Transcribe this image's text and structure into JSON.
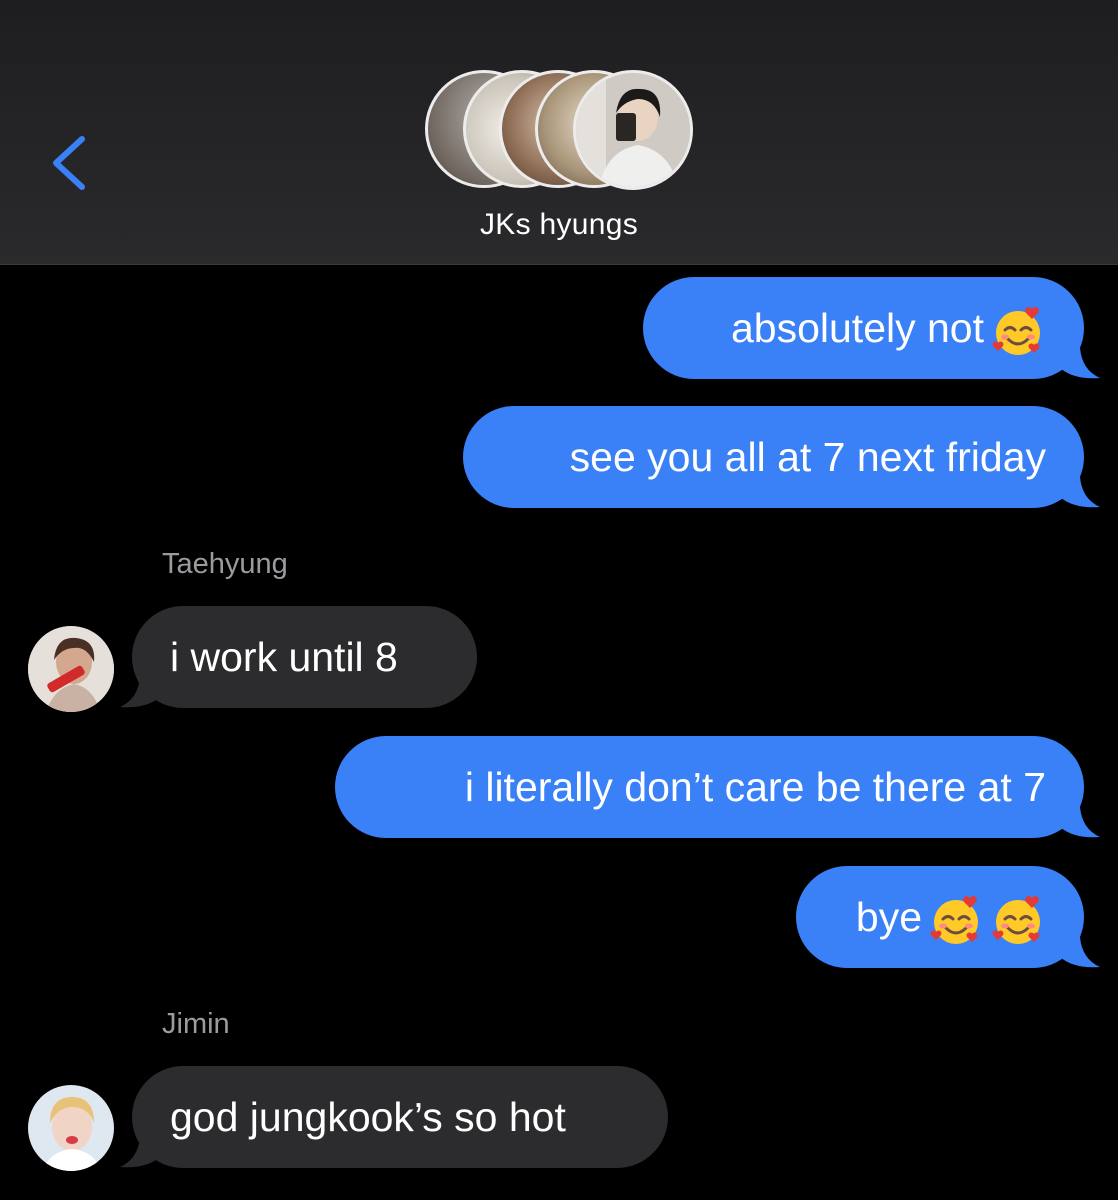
{
  "header": {
    "back_icon": "chevron-left-icon",
    "group_name": "JKs hyungs",
    "group_avatar_count": 5
  },
  "messages": [
    {
      "direction": "sent",
      "text": "absolutely not",
      "emojis": [
        "smiling-face-with-hearts"
      ]
    },
    {
      "direction": "sent",
      "text": "see you all at 7 next friday",
      "emojis": []
    },
    {
      "direction": "received",
      "sender": "Taehyung",
      "text": "i work until 8",
      "emojis": []
    },
    {
      "direction": "sent",
      "text": "i literally don’t care be there at 7",
      "emojis": []
    },
    {
      "direction": "sent",
      "text": "bye",
      "emojis": [
        "smiling-face-with-hearts",
        "smiling-face-with-hearts"
      ]
    },
    {
      "direction": "received",
      "sender": "Jimin",
      "text": "god jungkook’s so hot",
      "emojis": []
    }
  ],
  "colors": {
    "sent_bubble": "#3a80f6",
    "received_bubble": "#2c2c2e",
    "back_accent": "#3a80f6",
    "background": "#000000"
  }
}
